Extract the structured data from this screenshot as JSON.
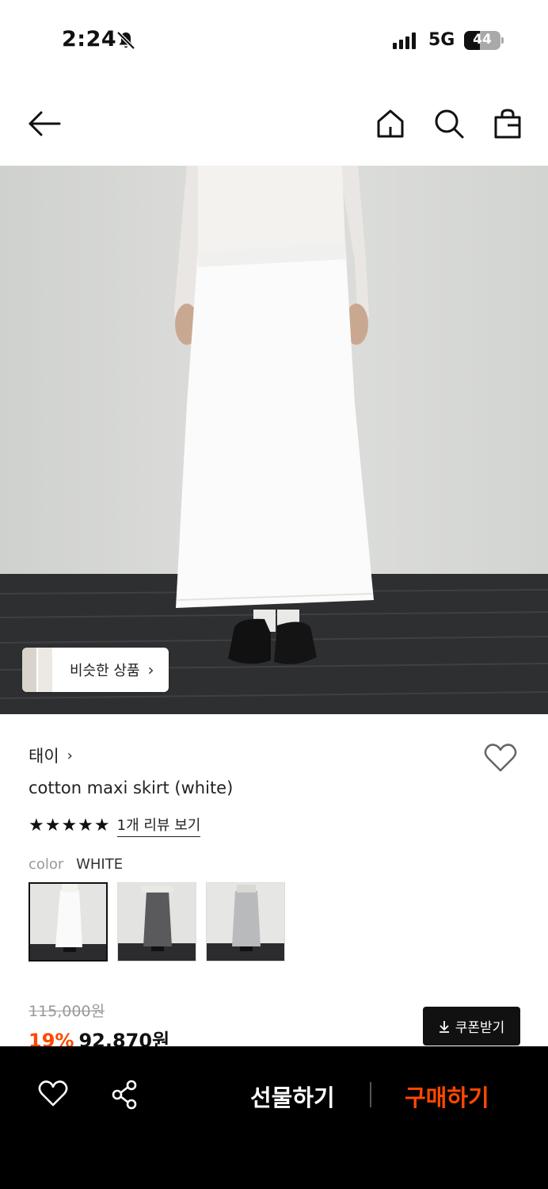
{
  "status": {
    "time": "2:24",
    "network": "5G",
    "battery": "44",
    "battery_level": 0.44
  },
  "nav": {
    "back_icon": "arrow-left-icon",
    "home_icon": "home-icon",
    "search_icon": "search-icon",
    "bag_icon": "shopping-bag-icon"
  },
  "similar": {
    "label": "비슷한 상품",
    "chevron": "›"
  },
  "product": {
    "brand": "태이",
    "brand_chevron": "›",
    "title": "cotton maxi skirt (white)",
    "stars": "★★★★★",
    "rating": 5,
    "review_link": "1개 리뷰 보기",
    "color_label": "color",
    "color_value": "WHITE",
    "swatches": [
      "white",
      "charcoal",
      "light gray"
    ],
    "selected_swatch": 0
  },
  "price": {
    "original": "115,000원",
    "discount": "19%",
    "current": "92,870원",
    "coupon_label": "쿠폰받기"
  },
  "bottom_bar": {
    "wishlist_icon": "heart-icon",
    "share_icon": "share-icon",
    "gift_label": "선물하기",
    "buy_label": "구매하기"
  },
  "colors": {
    "accent": "#ff4800",
    "bottom_bar_bg": "#000000"
  }
}
